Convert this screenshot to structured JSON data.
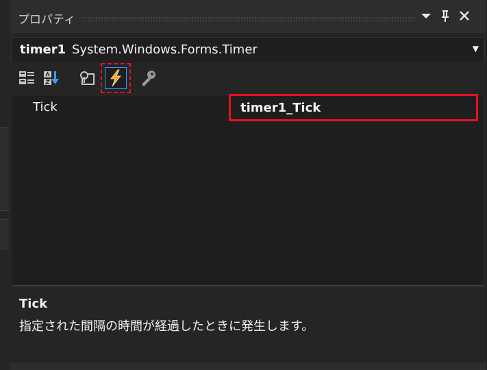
{
  "window": {
    "title": "プロパティ",
    "dropdown_icon": "triangle-down-icon",
    "pin_icon": "pin-icon",
    "close_icon": "close-icon"
  },
  "selector": {
    "object_name": "timer1",
    "object_type": "System.Windows.Forms.Timer"
  },
  "toolbar": {
    "items": [
      "categorized-icon",
      "alphabetical-icon",
      "properties-icon",
      "events-icon",
      "property-pages-icon"
    ],
    "selected": "events-icon"
  },
  "grid": {
    "rows": [
      {
        "name": "Tick",
        "value": "timer1_Tick"
      }
    ]
  },
  "description": {
    "title": "Tick",
    "text": "指定された間隔の時間が経過したときに発生します。"
  },
  "colors": {
    "highlight": "#e81123",
    "selection": "#3399ff",
    "background": "#1e1e1e",
    "panel": "#252526"
  }
}
